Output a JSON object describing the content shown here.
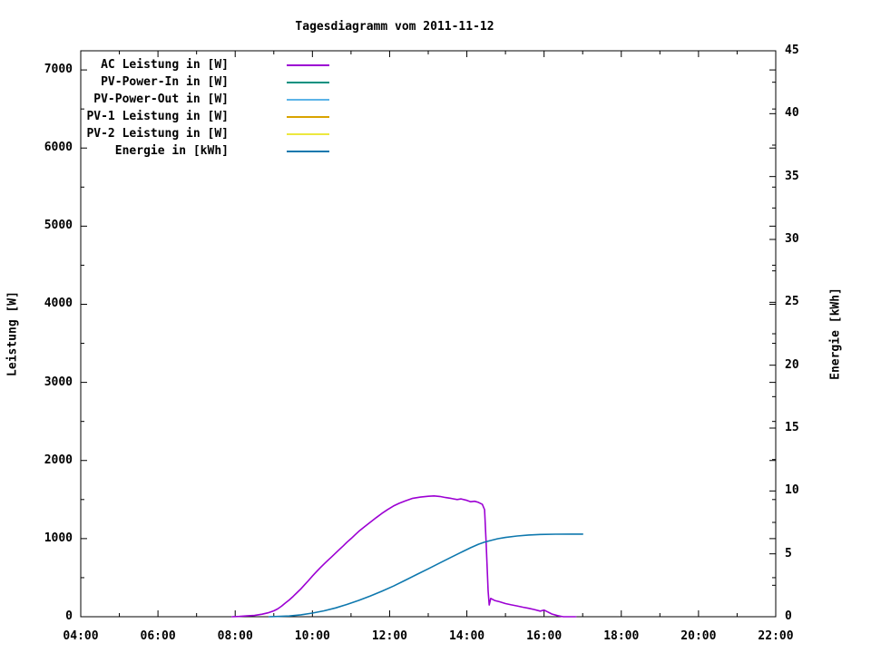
{
  "title": "Tagesdiagramm vom 2011-11-12",
  "y_left_label": "Leistung [W]",
  "y_right_label": "Energie [kWh]",
  "legend": {
    "items": [
      {
        "label": "AC Leistung in [W]",
        "color": "#9c00d3"
      },
      {
        "label": "PV-Power-In in [W]",
        "color": "#009180"
      },
      {
        "label": "PV-Power-Out in [W]",
        "color": "#5cb4e8"
      },
      {
        "label": "PV-1 Leistung in [W]",
        "color": "#d9a300"
      },
      {
        "label": "PV-2 Leistung in [W]",
        "color": "#ece83f"
      },
      {
        "label": "Energie in [kWh]",
        "color": "#0e78ae"
      }
    ]
  },
  "chart_data": {
    "type": "line",
    "title": "Tagesdiagramm vom 2011-11-12",
    "xlabel": "",
    "ylabel": "Leistung [W]",
    "y2label": "Energie [kWh]",
    "xlim_hours": [
      4,
      22
    ],
    "ylim_left": [
      0,
      7245
    ],
    "ylim_right": [
      0,
      45
    ],
    "grid": false,
    "legend_position": "top-left-inside",
    "x_ticks": [
      {
        "t": 4,
        "label": "04:00"
      },
      {
        "t": 6,
        "label": "06:00"
      },
      {
        "t": 8,
        "label": "08:00"
      },
      {
        "t": 10,
        "label": "10:00"
      },
      {
        "t": 12,
        "label": "12:00"
      },
      {
        "t": 14,
        "label": "14:00"
      },
      {
        "t": 16,
        "label": "16:00"
      },
      {
        "t": 18,
        "label": "18:00"
      },
      {
        "t": 20,
        "label": "20:00"
      },
      {
        "t": 22,
        "label": "22:00"
      }
    ],
    "x_minor_hours": [
      5,
      7,
      9,
      11,
      13,
      15,
      17,
      19,
      21
    ],
    "y_ticks": [
      {
        "v": 0,
        "label": "0"
      },
      {
        "v": 1000,
        "label": "1000"
      },
      {
        "v": 2000,
        "label": "2000"
      },
      {
        "v": 3000,
        "label": "3000"
      },
      {
        "v": 4000,
        "label": "4000"
      },
      {
        "v": 5000,
        "label": "5000"
      },
      {
        "v": 6000,
        "label": "6000"
      },
      {
        "v": 7000,
        "label": "7000"
      }
    ],
    "y_minor": [
      500,
      1500,
      2500,
      3500,
      4500,
      5500,
      6500
    ],
    "y2_ticks": [
      {
        "v": 0,
        "label": "0"
      },
      {
        "v": 5,
        "label": "5"
      },
      {
        "v": 10,
        "label": "10"
      },
      {
        "v": 15,
        "label": "15"
      },
      {
        "v": 20,
        "label": "20"
      },
      {
        "v": 25,
        "label": "25"
      },
      {
        "v": 30,
        "label": "30"
      },
      {
        "v": 35,
        "label": "35"
      },
      {
        "v": 40,
        "label": "40"
      },
      {
        "v": 45,
        "label": "45"
      }
    ],
    "y2_minor": [
      2.5,
      7.5,
      12.5,
      17.5,
      22.5,
      27.5,
      32.5,
      37.5,
      42.5
    ],
    "series": [
      {
        "name": "AC Leistung in [W]",
        "color": "#9c00d3",
        "axis": "left",
        "points": [
          [
            7.92,
            0
          ],
          [
            8.1,
            4
          ],
          [
            8.3,
            10
          ],
          [
            8.5,
            16
          ],
          [
            8.7,
            32
          ],
          [
            8.85,
            50
          ],
          [
            9.0,
            75
          ],
          [
            9.1,
            100
          ],
          [
            9.2,
            135
          ],
          [
            9.3,
            175
          ],
          [
            9.4,
            215
          ],
          [
            9.5,
            260
          ],
          [
            9.6,
            308
          ],
          [
            9.7,
            356
          ],
          [
            9.8,
            410
          ],
          [
            9.9,
            465
          ],
          [
            10.0,
            520
          ],
          [
            10.1,
            574
          ],
          [
            10.2,
            625
          ],
          [
            10.3,
            674
          ],
          [
            10.4,
            722
          ],
          [
            10.5,
            768
          ],
          [
            10.6,
            815
          ],
          [
            10.7,
            862
          ],
          [
            10.8,
            908
          ],
          [
            10.9,
            955
          ],
          [
            11.0,
            1000
          ],
          [
            11.1,
            1046
          ],
          [
            11.2,
            1092
          ],
          [
            11.35,
            1152
          ],
          [
            11.5,
            1210
          ],
          [
            11.65,
            1268
          ],
          [
            11.8,
            1322
          ],
          [
            11.95,
            1372
          ],
          [
            12.1,
            1418
          ],
          [
            12.25,
            1452
          ],
          [
            12.4,
            1482
          ],
          [
            12.6,
            1516
          ],
          [
            12.8,
            1532
          ],
          [
            13.0,
            1542
          ],
          [
            13.15,
            1546
          ],
          [
            13.3,
            1540
          ],
          [
            13.45,
            1526
          ],
          [
            13.6,
            1514
          ],
          [
            13.75,
            1500
          ],
          [
            13.85,
            1508
          ],
          [
            14.0,
            1490
          ],
          [
            14.1,
            1472
          ],
          [
            14.2,
            1478
          ],
          [
            14.3,
            1464
          ],
          [
            14.4,
            1438
          ],
          [
            14.46,
            1370
          ],
          [
            14.5,
            950
          ],
          [
            14.55,
            330
          ],
          [
            14.58,
            150
          ],
          [
            14.62,
            235
          ],
          [
            14.72,
            208
          ],
          [
            14.85,
            192
          ],
          [
            15.0,
            168
          ],
          [
            15.15,
            152
          ],
          [
            15.3,
            138
          ],
          [
            15.45,
            122
          ],
          [
            15.6,
            108
          ],
          [
            15.75,
            92
          ],
          [
            15.9,
            72
          ],
          [
            16.0,
            85
          ],
          [
            16.1,
            60
          ],
          [
            16.2,
            35
          ],
          [
            16.35,
            14
          ],
          [
            16.45,
            5
          ],
          [
            16.5,
            0
          ],
          [
            16.82,
            0
          ]
        ]
      },
      {
        "name": "PV-Power-In in [W]",
        "color": "#009180",
        "axis": "left",
        "points": []
      },
      {
        "name": "PV-Power-Out in [W]",
        "color": "#5cb4e8",
        "axis": "left",
        "points": []
      },
      {
        "name": "PV-1 Leistung in [W]",
        "color": "#d9a300",
        "axis": "left",
        "points": []
      },
      {
        "name": "PV-2 Leistung in [W]",
        "color": "#ece83f",
        "axis": "left",
        "points": []
      },
      {
        "name": "Energie in [kWh]",
        "color": "#0e78ae",
        "axis": "right",
        "points": [
          [
            8.88,
            0
          ],
          [
            9.1,
            0.02
          ],
          [
            9.4,
            0.06
          ],
          [
            9.7,
            0.15
          ],
          [
            10.0,
            0.29
          ],
          [
            10.3,
            0.47
          ],
          [
            10.6,
            0.7
          ],
          [
            10.9,
            0.98
          ],
          [
            11.2,
            1.3
          ],
          [
            11.5,
            1.65
          ],
          [
            11.8,
            2.03
          ],
          [
            12.1,
            2.44
          ],
          [
            12.4,
            2.89
          ],
          [
            12.7,
            3.35
          ],
          [
            13.0,
            3.81
          ],
          [
            13.3,
            4.28
          ],
          [
            13.6,
            4.74
          ],
          [
            13.9,
            5.19
          ],
          [
            14.1,
            5.49
          ],
          [
            14.3,
            5.76
          ],
          [
            14.45,
            5.92
          ],
          [
            14.6,
            6.05
          ],
          [
            14.8,
            6.2
          ],
          [
            15.0,
            6.3
          ],
          [
            15.3,
            6.42
          ],
          [
            15.6,
            6.5
          ],
          [
            15.9,
            6.54
          ],
          [
            16.3,
            6.56
          ],
          [
            16.7,
            6.57
          ],
          [
            17.0,
            6.57
          ]
        ]
      }
    ]
  }
}
